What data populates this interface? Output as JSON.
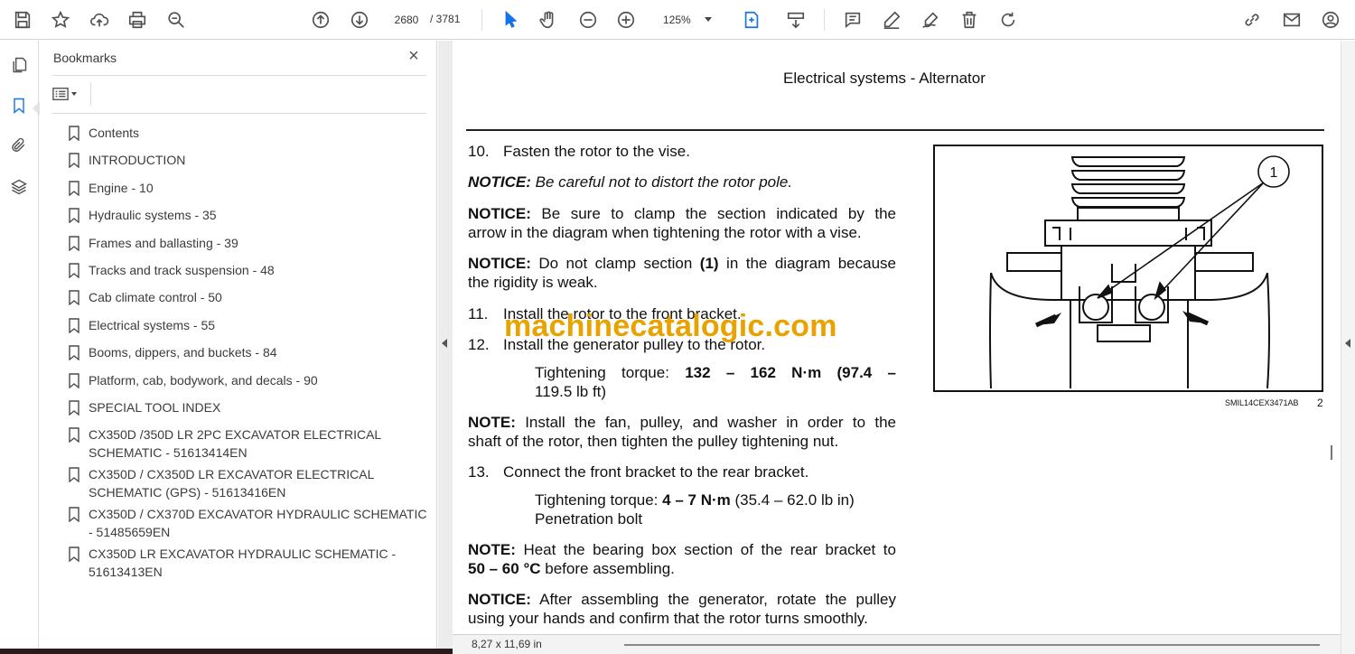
{
  "toolbar": {
    "page_current": "2680",
    "page_total": "/ 3781",
    "zoom": "125%",
    "icons": [
      "save-icon",
      "star-icon",
      "cloud-upload-icon",
      "print-icon",
      "zoom-search-icon",
      "page-up-icon",
      "page-down-icon",
      "select-cursor-icon",
      "hand-pan-icon",
      "zoom-out-icon",
      "zoom-in-icon",
      "fit-page-icon",
      "scroll-mode-icon",
      "comment-icon",
      "highlight-pen-icon",
      "sign-icon",
      "delete-icon",
      "rotate-icon",
      "share-link-icon",
      "mail-icon",
      "account-icon"
    ]
  },
  "rail": {
    "icons": [
      "pages-icon",
      "bookmark-icon",
      "attachment-icon",
      "layers-icon"
    ]
  },
  "bookmarks": {
    "title": "Bookmarks",
    "close_label": "×",
    "items": [
      {
        "label": "Contents"
      },
      {
        "label": "INTRODUCTION"
      },
      {
        "label": "Engine - 10"
      },
      {
        "label": "Hydraulic systems - 35"
      },
      {
        "label": "Frames and ballasting - 39"
      },
      {
        "label": "Tracks and track suspension - 48"
      },
      {
        "label": "Cab climate control - 50"
      },
      {
        "label": "Electrical systems - 55"
      },
      {
        "label": "Booms, dippers, and buckets - 84"
      },
      {
        "label": "Platform, cab, bodywork, and decals - 90"
      },
      {
        "label": "SPECIAL TOOL INDEX"
      },
      {
        "label": "CX350D /350D LR 2PC EXCAVATOR ELECTRICAL SCHEMATIC - 51613414EN"
      },
      {
        "label": "CX350D / CX350D LR EXCAVATOR ELECTRICAL SCHEMATIC (GPS) - 51613416EN"
      },
      {
        "label": "CX350D / CX370D EXCAVATOR HYDRAULIC SCHEMATIC - 51485659EN"
      },
      {
        "label": "CX350D LR EXCAVATOR HYDRAULIC SCHEMATIC - 51613413EN"
      }
    ]
  },
  "document": {
    "header": "Electrical systems - Alternator",
    "step10_num": "10.",
    "step10": "Fasten the rotor to the vise.",
    "notice1_label": "NOTICE:",
    "notice1": "Be careful not to distort the rotor pole.",
    "notice2_label": "NOTICE:",
    "notice2_a": "Be sure to clamp the section indicated by the",
    "notice2_b": "arrow in the diagram when tightening the rotor with a vise.",
    "notice3_label": "NOTICE:",
    "notice3_a1": "Do not clamp section",
    "notice3_ref": "(1)",
    "notice3_a2": "in the diagram because",
    "notice3_b": "the rigidity is weak.",
    "step11_num": "11.",
    "step11": "Install the rotor to the front bracket.",
    "step12_num": "12.",
    "step12": "Install the generator pulley to the rotor.",
    "torque1_label": "Tightening  torque:",
    "torque1_value_a": "132  –  162 N·m",
    "torque1_value_b": "(97.4  –",
    "torque1_value_c": "119.5 lb ft)",
    "note1_label": "NOTE:",
    "note1_a": "Install the fan, pulley, and washer in order to the",
    "note1_b": "shaft of the rotor, then tighten the pulley tightening nut.",
    "step13_num": "13.",
    "step13": "Connect the front bracket to the rear bracket.",
    "torque2_label": "Tightening torque:",
    "torque2_value": "4 – 7 N·m",
    "torque2_imperial": "(35.4 – 62.0 lb in)",
    "torque2_bolt": "Penetration bolt",
    "note2_label": "NOTE:",
    "note2_a": "Heat the bearing box section of the rear bracket to",
    "note2_b_value": "50 – 60 °C",
    "note2_b": "before assembling.",
    "notice4_label": "NOTICE:",
    "notice4_a": "After assembling the generator, rotate the pulley",
    "notice4_b": "using your hands and confirm that the rotor turns smoothly.",
    "watermark": "machinecatalogic.com",
    "figure_callout": "1",
    "figure_code": "SMIL14CEX3471AB",
    "figure_index": "2"
  },
  "status": {
    "page_size": "8,27 x 11,69 in"
  }
}
